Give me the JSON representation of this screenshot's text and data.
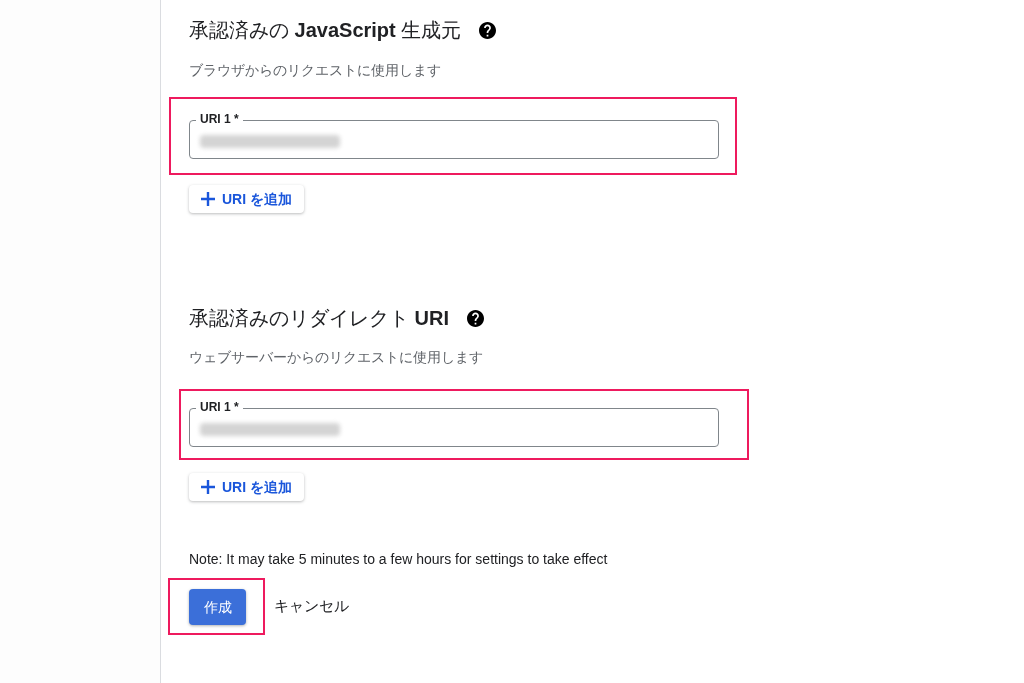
{
  "sections": [
    {
      "title": "承認済みの **JavaScript** 生成元",
      "subtitle": "ブラウザからのリクエストに使用します",
      "uris": [
        {
          "label": "URI 1 *",
          "redacted": true,
          "highlighted": true
        }
      ],
      "add_button": "URI を追加"
    },
    {
      "title": "承認済みのリダイレクト **URI**",
      "subtitle": "ウェブサーバーからのリクエストに使用します",
      "uris": [
        {
          "label": "URI 1 *",
          "redacted": true,
          "highlighted": true
        }
      ],
      "add_button": "URI を追加"
    }
  ],
  "note": "Note: It may take 5 minutes to a few hours for settings to take effect",
  "actions": {
    "create": {
      "label": "作成",
      "highlighted": true
    },
    "cancel": "キャンセル"
  }
}
